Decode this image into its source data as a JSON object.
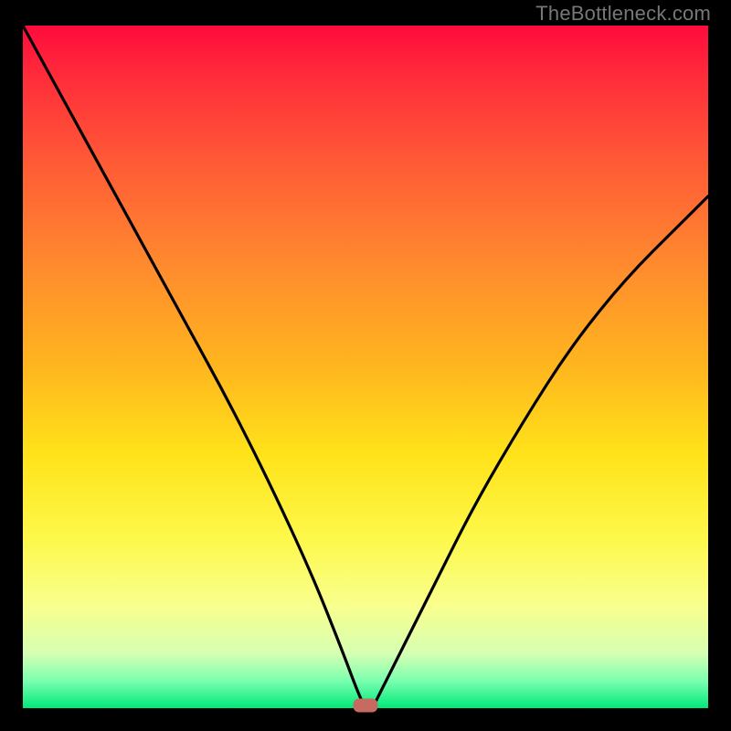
{
  "watermark": "TheBottleneck.com",
  "chart_data": {
    "type": "line",
    "title": "",
    "xlabel": "",
    "ylabel": "",
    "xlim": [
      0,
      100
    ],
    "ylim": [
      0,
      100
    ],
    "grid": false,
    "legend": false,
    "series": [
      {
        "name": "bottleneck-curve",
        "x": [
          0,
          6,
          12,
          18,
          24,
          30,
          36,
          42,
          46,
          49,
          50,
          51,
          52,
          55,
          60,
          66,
          73,
          80,
          88,
          96,
          100
        ],
        "y": [
          100,
          89,
          78,
          67,
          56,
          45,
          33,
          20,
          10,
          2,
          0,
          0,
          2,
          8,
          18,
          30,
          42,
          53,
          63,
          71,
          75
        ]
      }
    ],
    "bottleneck_marker": {
      "x": 50,
      "y": 0
    },
    "gradient_stops": [
      {
        "pct": 0,
        "color": "#ff0b3c"
      },
      {
        "pct": 8,
        "color": "#ff2e3a"
      },
      {
        "pct": 20,
        "color": "#ff5a36"
      },
      {
        "pct": 35,
        "color": "#ff8a2e"
      },
      {
        "pct": 50,
        "color": "#ffb61e"
      },
      {
        "pct": 63,
        "color": "#ffe31a"
      },
      {
        "pct": 75,
        "color": "#fdf84a"
      },
      {
        "pct": 85,
        "color": "#f9ff8e"
      },
      {
        "pct": 92,
        "color": "#d6ffb2"
      },
      {
        "pct": 96,
        "color": "#7bffb0"
      },
      {
        "pct": 100,
        "color": "#00e978"
      }
    ]
  }
}
